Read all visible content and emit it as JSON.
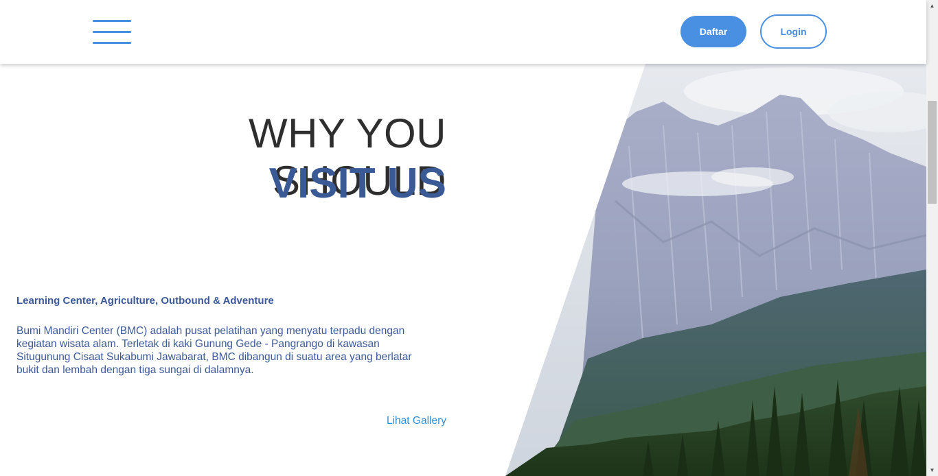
{
  "header": {
    "menu_icon": "hamburger-menu-icon",
    "register_label": "Daftar",
    "login_label": "Login"
  },
  "hero": {
    "title_line1": "WHY YOU SHOULD",
    "title_line2": "VISIT US",
    "subtitle": "Learning Center, Agriculture, Outbound & Adventure",
    "description": "Bumi Mandiri Center (BMC) adalah pusat pelatihan yang menyatu terpadu dengan kegiatan wisata alam. Terletak di kaki Gunung Gede - Pangrango di kawasan Situgunung Cisaat Sukabumi Jawabarat, BMC dibangun di suatu area yang berlatar bukit dan lembah dengan tiga sungai di dalamnya.",
    "gallery_link": "Lihat Gallery"
  },
  "colors": {
    "accent": "#4a90e2",
    "heading_dark": "#2e2e2e",
    "heading_blue": "#3a5a95",
    "text_blue": "#3b5898",
    "link_blue": "#2f8fd8"
  },
  "scrollbar": {
    "up_icon": "arrow-up-icon",
    "down_icon": "arrow-down-icon"
  }
}
